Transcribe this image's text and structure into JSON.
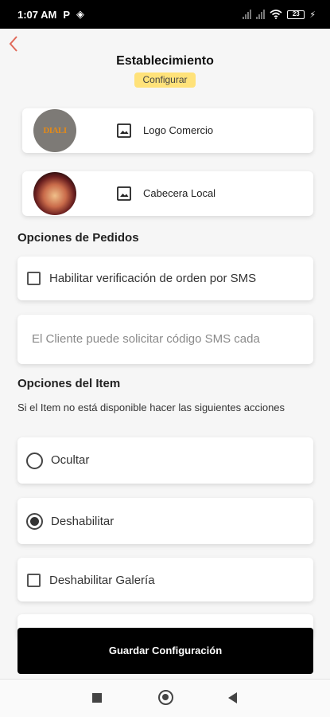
{
  "status_bar": {
    "time": "1:07 AM",
    "p_glyph": "P",
    "battery": "23"
  },
  "header": {
    "title": "Establecimiento",
    "badge": "Configurar"
  },
  "images": [
    {
      "label": "Logo Comercio",
      "logo_text": "DIALI"
    },
    {
      "label": "Cabecera Local"
    }
  ],
  "orders": {
    "title": "Opciones de Pedidos",
    "sms_checkbox_label": "Habilitar verificación de orden por SMS",
    "sms_interval_placeholder": "El Cliente puede solicitar código SMS cada"
  },
  "item_options": {
    "title": "Opciones del Item",
    "description": "Si el Item no está disponible hacer las siguientes acciones",
    "hide_label": "Ocultar",
    "disable_label": "Deshabilitar",
    "selected": "Deshabilitar",
    "disable_gallery_label": "Deshabilitar Galería"
  },
  "save_button": "Guardar Configuración",
  "colors": {
    "accent_badge": "#ffe27a",
    "back_arrow": "#e06a5a",
    "primary_button": "#000000"
  }
}
